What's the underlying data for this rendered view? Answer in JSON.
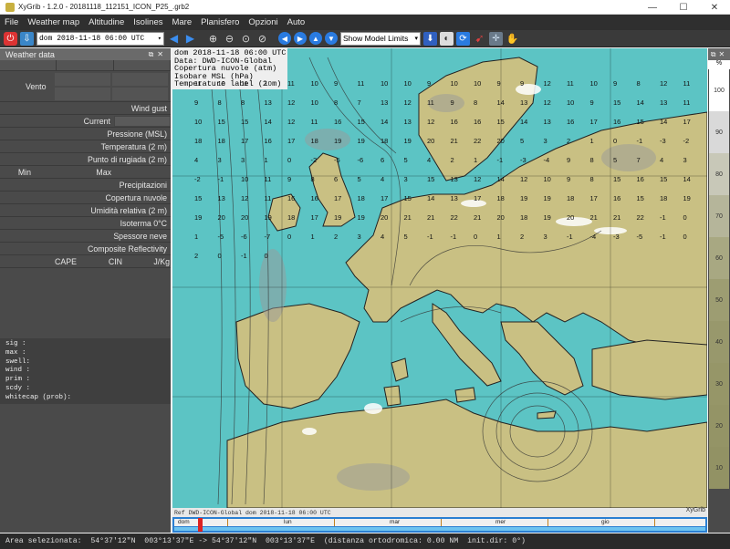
{
  "window": {
    "title": "XyGrib - 1.2.0 - 20181118_112151_ICON_P25_.grb2",
    "minimize": "—",
    "maximize": "☐",
    "close": "✕"
  },
  "menu": [
    "File",
    "Weather map",
    "Altitudine",
    "Isolines",
    "Mare",
    "Planisfero",
    "Opzioni",
    "Auto"
  ],
  "toolbar": {
    "date_select": "dom 2018-11-18 06:00 UTC",
    "model_select": "Show Model Limits"
  },
  "weather_panel": {
    "title": "Weather data",
    "vento": "Vento",
    "rows_a": [
      "Wind gust",
      "Current",
      "Pressione (MSL)",
      "Temperatura (2 m)",
      "Punto di rugiada (2 m)"
    ],
    "min": "Min",
    "max": "Max",
    "rows_b": [
      "Precipitazioni",
      "Copertura nuvole",
      "Umidità relativa (2 m)",
      "Isoterma 0°C",
      "Spessore neve",
      "Composite Reflectivity"
    ],
    "cape": "CAPE",
    "cin": "CIN",
    "jkg": "J/Kg",
    "wave_lines": [
      "sig  :",
      "max  :",
      "swell:",
      "wind :",
      "prim :",
      "scdy :",
      "whitecap (prob):"
    ]
  },
  "map": {
    "info": [
      "dom 2018-11-18 06:00 UTC",
      "Data: DWD-ICON-Global",
      "Copertura nuvole (atm)",
      "Isobare MSL (hPa)",
      "Temperature label (2 m)"
    ],
    "bottom_ref": "Ref DWD-ICON-Global  dom 2018-11-18 06:00 UTC",
    "brand": "XyGrib"
  },
  "colorbar": {
    "unit": "%",
    "labels": [
      "100",
      "90",
      "80",
      "70",
      "60",
      "50",
      "40",
      "30",
      "20",
      "10"
    ],
    "colors": [
      "#ffffff",
      "#d9d9d9",
      "#c8c8b8",
      "#b5b59a",
      "#a8a882",
      "#9d9d72",
      "#98986c",
      "#969668",
      "#949466",
      "#929264"
    ]
  },
  "timeline": {
    "days": [
      "dom",
      "lun",
      "mar",
      "mer",
      "gio"
    ],
    "accent": "#2a7fd2"
  },
  "status": "Area selezionata:  54°37'12\"N  003°13'37\"E -> 54°37'12\"N  003°13'37\"E  (distanza ortodromica: 0.00 NM  init.dir: 0°)",
  "map_labels": [
    "11",
    "10",
    "11",
    "10",
    "11",
    "10",
    "9",
    "11",
    "10",
    "10",
    "9",
    "10",
    "10",
    "9",
    "9",
    "12",
    "11",
    "10",
    "9",
    "8",
    "12",
    "11",
    "9",
    "8",
    "8",
    "13",
    "12",
    "10",
    "8",
    "7",
    "13",
    "12",
    "11",
    "9",
    "8",
    "14",
    "13",
    "12",
    "10",
    "9",
    "15",
    "14",
    "13",
    "11",
    "10",
    "15",
    "15",
    "14",
    "12",
    "11",
    "16",
    "15",
    "14",
    "13",
    "12",
    "16",
    "16",
    "15",
    "14",
    "13",
    "16",
    "17",
    "16",
    "15",
    "14",
    "17",
    "18",
    "18",
    "17",
    "16",
    "17",
    "18",
    "19",
    "19",
    "18",
    "19",
    "20",
    "21",
    "22",
    "20",
    "5",
    "3",
    "2",
    "1",
    "0",
    "-1",
    "-3",
    "-2",
    "4",
    "3",
    "3",
    "1",
    "0",
    "-2",
    "-5",
    "-6",
    "6",
    "5",
    "4",
    "2",
    "1",
    "-1",
    "-3",
    "-4",
    "9",
    "8",
    "5",
    "7",
    "4",
    "3",
    "-2",
    "-1",
    "10",
    "11",
    "9",
    "8",
    "6",
    "5",
    "4",
    "3",
    "15",
    "13",
    "12",
    "14",
    "12",
    "10",
    "9",
    "8",
    "15",
    "16",
    "15",
    "14",
    "15",
    "13",
    "12",
    "11",
    "16",
    "16",
    "17",
    "18",
    "17",
    "15",
    "14",
    "13",
    "17",
    "18",
    "19",
    "19",
    "18",
    "17",
    "16",
    "15",
    "18",
    "19",
    "19",
    "20",
    "20",
    "19",
    "18",
    "17",
    "19",
    "19",
    "20",
    "21",
    "21",
    "22",
    "21",
    "20",
    "18",
    "19",
    "20",
    "21",
    "21",
    "22",
    "-1",
    "0",
    "1",
    "-5",
    "-6",
    "-7",
    "0",
    "1",
    "2",
    "3",
    "4",
    "5",
    "-1",
    "-1",
    "0",
    "1",
    "2",
    "3",
    "-1",
    "-4",
    "-3",
    "-5",
    "-1",
    "0",
    "2",
    "0",
    "-1",
    "0"
  ]
}
